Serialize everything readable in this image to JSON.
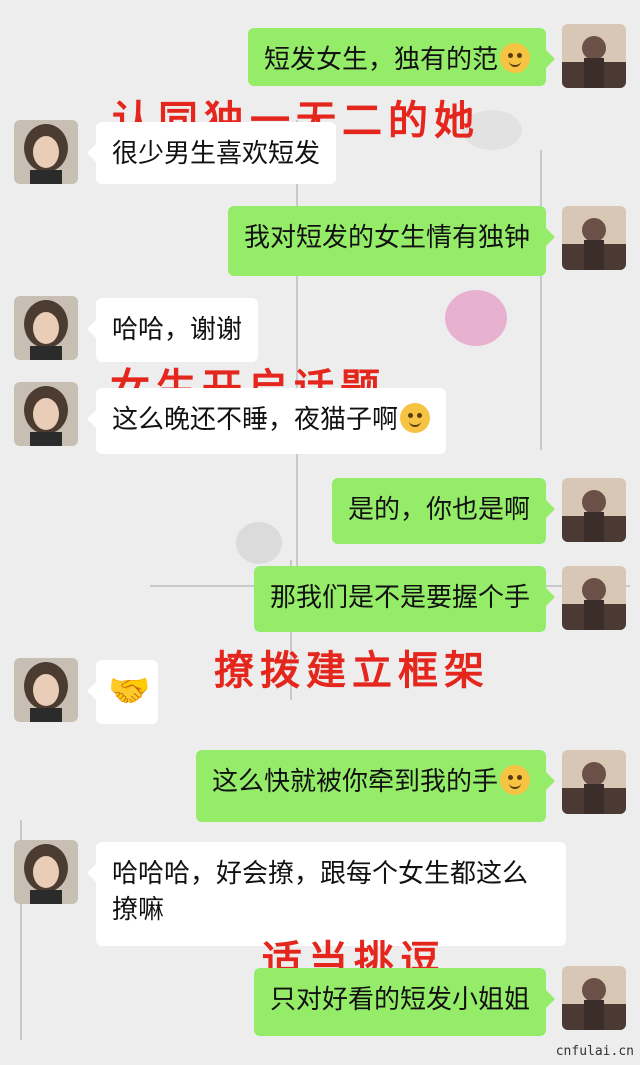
{
  "messages": [
    {
      "side": "out",
      "text": "短发女生，独有的范",
      "emoji": "smirk-emoji"
    },
    {
      "side": "in",
      "text": "很少男生喜欢短发"
    },
    {
      "side": "out",
      "text": "我对短发的女生情有独钟"
    },
    {
      "side": "in",
      "text": "哈哈，谢谢"
    },
    {
      "side": "in",
      "text": "这么晚还不睡，夜猫子啊",
      "emoji": "smile-emoji"
    },
    {
      "side": "out",
      "text": "是的，你也是啊"
    },
    {
      "side": "out",
      "text": "那我们是不是要握个手"
    },
    {
      "side": "in",
      "text": "",
      "emoji": "handshake-emoji"
    },
    {
      "side": "out",
      "text": "这么快就被你牵到我的手",
      "emoji": "blush-emoji"
    },
    {
      "side": "in",
      "text": "哈哈哈，好会撩，跟每个女生都这么撩嘛"
    },
    {
      "side": "out",
      "text": "只对好看的短发小姐姐"
    }
  ],
  "annotations": {
    "a1": "认同独一无二的她",
    "a2": "女生开启话题",
    "a3": "撩拨建立框架",
    "a4": "适当挑逗"
  },
  "footer": "cnfulai.cn",
  "colors": {
    "outgoing_bubble": "#95ec69",
    "incoming_bubble": "#ffffff",
    "annotation": "#e4261d",
    "background": "#ededed"
  }
}
